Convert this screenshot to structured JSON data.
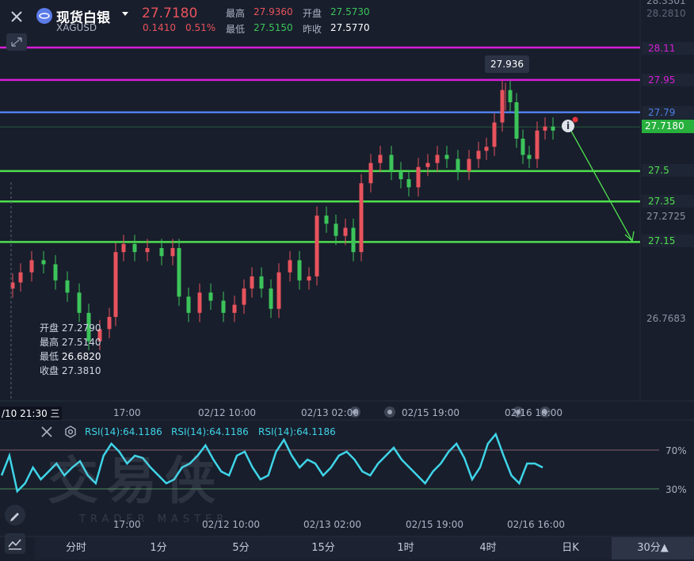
{
  "header": {
    "close_icon": "close-icon",
    "collapse_icon": "collapse-icon",
    "logo_icon": "silver-logo-icon",
    "symbol_name": "现货白银",
    "symbol_code": "XAGUSD",
    "price": "27.7180",
    "change": "0.1410",
    "change_pct": "0.51%",
    "high_label": "最高",
    "high_value": "27.9360",
    "open_label": "开盘",
    "open_value": "27.5730",
    "low_label": "最低",
    "low_value": "27.5150",
    "prev_close_label": "昨收",
    "prev_close_value": "27.5770",
    "colors": {
      "up": "#e8535d",
      "down": "#3cc45a",
      "brand": "#5b7be8"
    }
  },
  "price_axis": {
    "top_partial": "28.3301",
    "ticks": [
      "28.2810",
      "27.2725",
      "26.7683"
    ],
    "current_price": "27.7180"
  },
  "levels": [
    {
      "value": 28.11,
      "label": "28.11",
      "color": "#d61fd6"
    },
    {
      "value": 27.95,
      "label": "27.95",
      "color": "#d61fd6"
    },
    {
      "value": 27.79,
      "label": "27.79",
      "color": "#4f7ee8"
    },
    {
      "value": 27.5,
      "label": "27.5",
      "color": "#4ee04e"
    },
    {
      "value": 27.35,
      "label": "27.35",
      "color": "#4ee04e"
    },
    {
      "value": 27.15,
      "label": "27.15",
      "color": "#4ee04e"
    }
  ],
  "annotations": {
    "peak_label": "27.936",
    "info_icon": "info-icon",
    "arrow": "projection-arrow-down"
  },
  "ohlc_tooltip": {
    "open_label": "开盘",
    "open_value": "27.2790",
    "high_label": "最高",
    "high_value": "27.5140",
    "low_label": "最低",
    "low_value": "26.6820",
    "close_label": "收盘",
    "close_value": "27.3810"
  },
  "time_axis": {
    "cursor_time": "/10 21:30 三",
    "ticks": [
      "17:00",
      "02/12 10:00",
      "02/13 02:00",
      "02/15 19:00",
      "02/16 16:00"
    ]
  },
  "rsi": {
    "labels": [
      "RSI(14):64.1186",
      "RSI(14):64.1186",
      "RSI(14):64.1186"
    ],
    "level_70": "70%",
    "level_30": "30%",
    "color": "#3fd4e8"
  },
  "watermark": {
    "main": "交易侠",
    "sub": "TRADER MASTER"
  },
  "tools": {
    "pen_icon": "pen-icon",
    "indicator_icon": "indicator-icon"
  },
  "tabs": [
    "分时",
    "1分",
    "5分",
    "15分",
    "1时",
    "4时",
    "日K",
    "30分▲"
  ],
  "active_tab": "30分▲",
  "chart_data": {
    "type": "candlestick",
    "series": [
      {
        "name": "XAGUSD",
        "values": []
      }
    ],
    "level_lines": [
      28.11,
      27.95,
      27.79,
      27.5,
      27.35,
      27.15
    ],
    "current": 27.718,
    "period_high": 27.936
  }
}
